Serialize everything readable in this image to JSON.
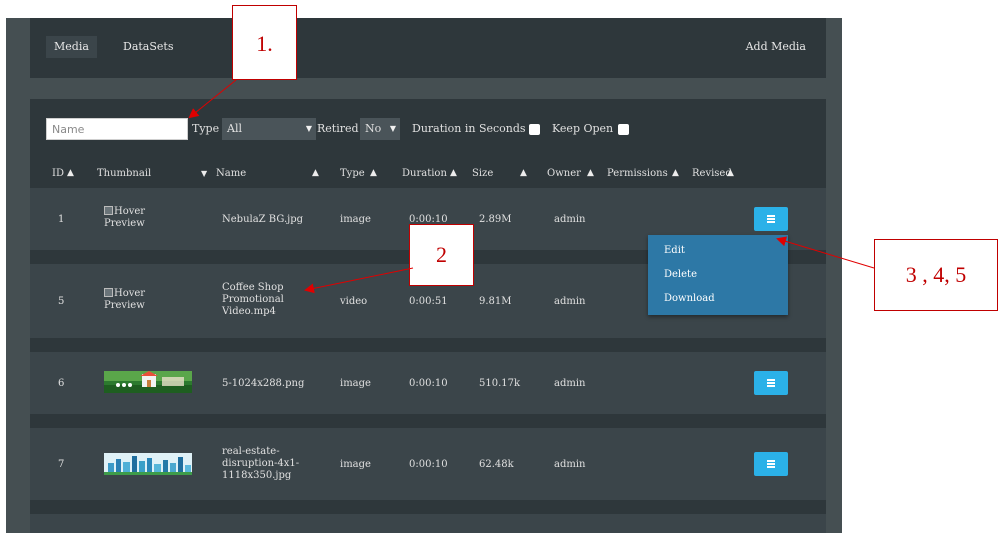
{
  "topbar": {
    "tabs": [
      {
        "label": "Media"
      },
      {
        "label": "DataSets"
      }
    ],
    "add_media_label": "Add Media"
  },
  "filters": {
    "name_placeholder": "Name",
    "type_label": "Type",
    "type_value": "All",
    "retired_label": "Retired",
    "retired_value": "No",
    "duration_label": "Duration in Seconds",
    "keep_open_label": "Keep Open"
  },
  "table": {
    "columns": [
      "ID",
      "Thumbnail",
      "Name",
      "Type",
      "Duration",
      "Size",
      "Owner",
      "Permissions",
      "Revised"
    ],
    "rows": [
      {
        "id": "1",
        "thumbnail_alt": "Hover Preview",
        "name": "NebulaZ BG.jpg",
        "type": "image",
        "duration": "0:00:10",
        "size": "2.89M",
        "owner": "admin"
      },
      {
        "id": "5",
        "thumbnail_alt": "Hover Preview",
        "name": "Coffee Shop Promotional Video.mp4",
        "type": "video",
        "duration": "0:00:51",
        "size": "9.81M",
        "owner": "admin"
      },
      {
        "id": "6",
        "thumbnail_alt": "",
        "name": "5-1024x288.png",
        "type": "image",
        "duration": "0:00:10",
        "size": "510.17k",
        "owner": "admin"
      },
      {
        "id": "7",
        "thumbnail_alt": "",
        "name": "real-estate-disruption-4x1-1118x350.jpg",
        "type": "image",
        "duration": "0:00:10",
        "size": "62.48k",
        "owner": "admin"
      }
    ]
  },
  "row_menu": {
    "items": [
      "Edit",
      "Delete",
      "Download"
    ]
  },
  "annotations": {
    "callout_1": "1.",
    "callout_2": "2",
    "callout_345": "3 , 4, 5"
  },
  "colors": {
    "accent": "#2bb1e8",
    "menu_bg": "#2d78a6",
    "annotation": "#c00000"
  }
}
